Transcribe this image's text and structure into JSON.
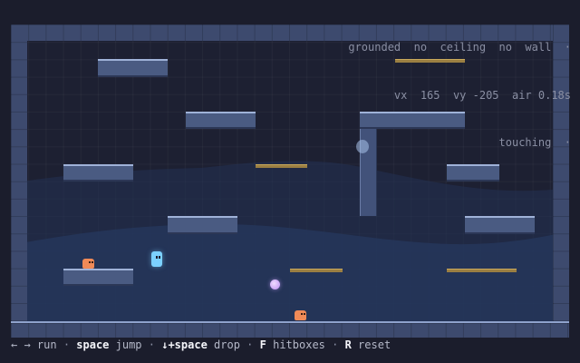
{
  "hud": {
    "line1": "grounded  no  ceiling  no  wall  ·",
    "line2": "vx  165  vy -205  air 0.18s",
    "line3": "touching  ·"
  },
  "help": {
    "run_keys": "← →",
    "run": " run ",
    "sep": "·",
    "jump_key": "space",
    "jump": " jump ",
    "drop_key": "↓+space",
    "drop": " drop ",
    "hitbox_key": "F",
    "hitbox": " hitboxes ",
    "reset_key": "R",
    "reset": " reset"
  },
  "colors": {
    "background": "#1b1d2c",
    "stage": "#1d2032",
    "solid": "#4a5b82",
    "solid_top": "#9fb2d8",
    "one_way": "#9b7f42",
    "player": "#7cd1ff",
    "enemy": "#f08a57",
    "gem": "#b98cf0"
  },
  "entities": {
    "player_icon": "player-character-icon",
    "enemy_icon": "slime-enemy-icon",
    "gem_icon": "gem-icon",
    "ghost_icon": "ghost-icon"
  }
}
